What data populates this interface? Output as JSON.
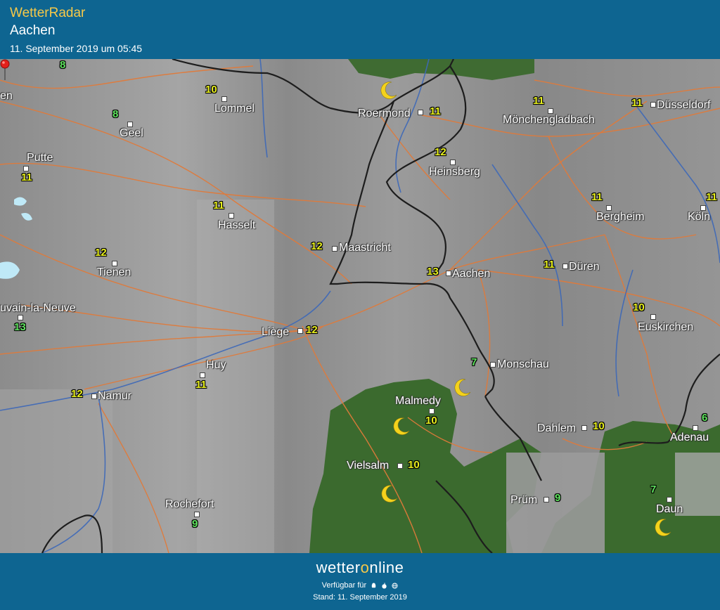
{
  "header": {
    "app_title": "WetterRadar",
    "city": "Aachen",
    "datetime": "11. September 2019 um 05:45"
  },
  "colors": {
    "header_bg": "#0e6591",
    "accent": "#f7c948",
    "map_gray": "#8f8f8f",
    "forest_green": "#3b6a2e",
    "roads": "#e07a3a",
    "rivers": "#3d68b8",
    "borders": "#1f1f1f"
  },
  "map": {
    "selected_city": "Aachen",
    "marker_icon": "location-pin-icon",
    "condition_icon": "crescent-moon-icon",
    "cities": [
      {
        "name": "Lommel",
        "temp": "10"
      },
      {
        "name": "Geel",
        "temp": "8"
      },
      {
        "name": "Putte",
        "temp": "11"
      },
      {
        "name": "Roermond",
        "temp": "11"
      },
      {
        "name": "Mönchengladbach",
        "temp": "11"
      },
      {
        "name": "Düsseldorf",
        "temp": "11"
      },
      {
        "name": "Heinsberg",
        "temp": "12"
      },
      {
        "name": "Hasselt",
        "temp": "11"
      },
      {
        "name": "Bergheim",
        "temp": "11"
      },
      {
        "name": "Köln",
        "temp": "11"
      },
      {
        "name": "Maastricht",
        "temp": "12"
      },
      {
        "name": "Tienen",
        "temp": "12"
      },
      {
        "name": "Aachen",
        "temp": "13"
      },
      {
        "name": "Düren",
        "temp": "11"
      },
      {
        "name": "uvain-la-Neuve",
        "temp": "13"
      },
      {
        "name": "Euskirchen",
        "temp": "10"
      },
      {
        "name": "Liège",
        "temp": "12"
      },
      {
        "name": "Huy",
        "temp": "11"
      },
      {
        "name": "Monschau",
        "temp": "7"
      },
      {
        "name": "Namur",
        "temp": "12"
      },
      {
        "name": "Malmedy",
        "temp": "10"
      },
      {
        "name": "Dahlem",
        "temp": "10"
      },
      {
        "name": "Adenau",
        "temp": "6"
      },
      {
        "name": "Vielsalm",
        "temp": "10"
      },
      {
        "name": "Prüm",
        "temp": "9"
      },
      {
        "name": "Rochefort",
        "temp": "9"
      },
      {
        "name": "Daun",
        "temp": "7"
      }
    ],
    "edge_labels": [
      {
        "text": "8"
      },
      {
        "text": "en"
      }
    ]
  },
  "footer": {
    "brand_prefix": "wetter",
    "brand_o": "o",
    "brand_suffix": "nline",
    "available_text": "Verfügbar für",
    "platform_icons": [
      "android-icon",
      "apple-icon",
      "web-icon"
    ],
    "stand": "Stand: 11. September 2019"
  }
}
